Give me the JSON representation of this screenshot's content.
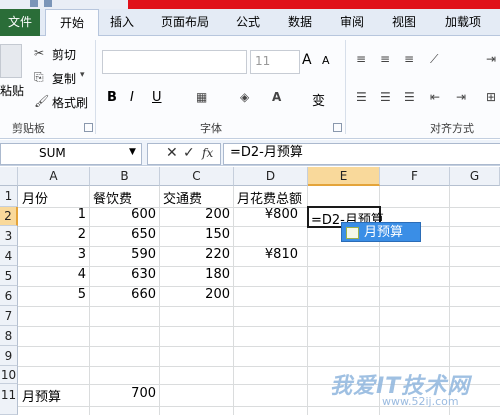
{
  "tabs": {
    "file": "文件",
    "home": "开始",
    "insert": "插入",
    "page_layout": "页面布局",
    "formulas": "公式",
    "data": "数据",
    "review": "审阅",
    "view": "视图",
    "addins": "加载项"
  },
  "ribbon": {
    "clipboard": {
      "paste": "粘贴",
      "cut": "剪切",
      "copy": "复制",
      "format_painter": "格式刷",
      "group_label": "剪贴板"
    },
    "font": {
      "size": "11",
      "grow": "A",
      "shrink": "A",
      "bold": "B",
      "italic": "I",
      "underline": "U",
      "phonetic": "变",
      "group_label": "字体"
    },
    "alignment": {
      "group_label": "对齐方式"
    }
  },
  "formula_bar": {
    "name_box": "SUM",
    "cancel": "✕",
    "enter": "✓",
    "fx": "fx",
    "formula": "=D2-月预算"
  },
  "columns": [
    "A",
    "B",
    "C",
    "D",
    "E",
    "F",
    "G"
  ],
  "rows": [
    "1",
    "2",
    "3",
    "4",
    "5",
    "6",
    "7",
    "8",
    "9",
    "10",
    "11"
  ],
  "sheet": {
    "headers": {
      "A": "月份",
      "B": "餐饮费",
      "C": "交通费",
      "D": "月花费总额"
    },
    "data": [
      {
        "month": "1",
        "food": "600",
        "transport": "200",
        "total": "¥800"
      },
      {
        "month": "2",
        "food": "650",
        "transport": "150",
        "total": ""
      },
      {
        "month": "3",
        "food": "590",
        "transport": "220",
        "total": "¥810"
      },
      {
        "month": "4",
        "food": "630",
        "transport": "180",
        "total": ""
      },
      {
        "month": "5",
        "food": "660",
        "transport": "200",
        "total": ""
      }
    ],
    "budget_label": "月预算",
    "budget_value": "700",
    "editing_cell": "=D2-月预算"
  },
  "autocomplete": {
    "item": "月预算"
  },
  "watermark": {
    "text": "我爱IT技术网",
    "url": "www.52ij.com"
  }
}
